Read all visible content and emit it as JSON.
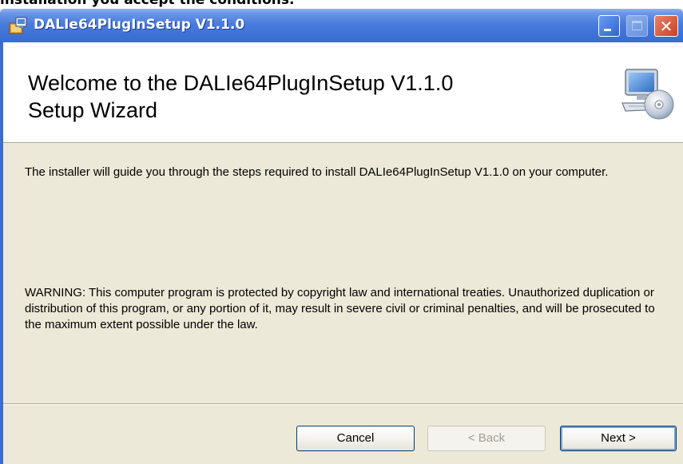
{
  "caption": "installation you accept the conditions.",
  "window": {
    "title": "DALIe64PlugInSetup V1.1.0",
    "minimize_icon": "minimize-icon",
    "maximize_icon": "maximize-icon",
    "close_icon": "close-icon",
    "close_glyph": "✕"
  },
  "banner": {
    "title_line1": "Welcome to the DALIe64PlugInSetup V1.1.0",
    "title_line2": "Setup Wizard",
    "icon": "computer-cd-icon"
  },
  "body": {
    "intro": "The installer will guide you through the steps required to install DALIe64PlugInSetup V1.1.0 on your computer.",
    "warning": "WARNING: This computer program is protected by copyright law and international treaties. Unauthorized duplication or distribution of this program, or any portion of it, may result in severe civil or criminal penalties, and will be prosecuted to the maximum extent possible under the law."
  },
  "buttons": {
    "cancel": "Cancel",
    "back": "< Back",
    "next": "Next >"
  },
  "colors": {
    "titlebar": "#3a6cd2",
    "dialog_face": "#ece9d8",
    "close_button": "#c8411f"
  }
}
